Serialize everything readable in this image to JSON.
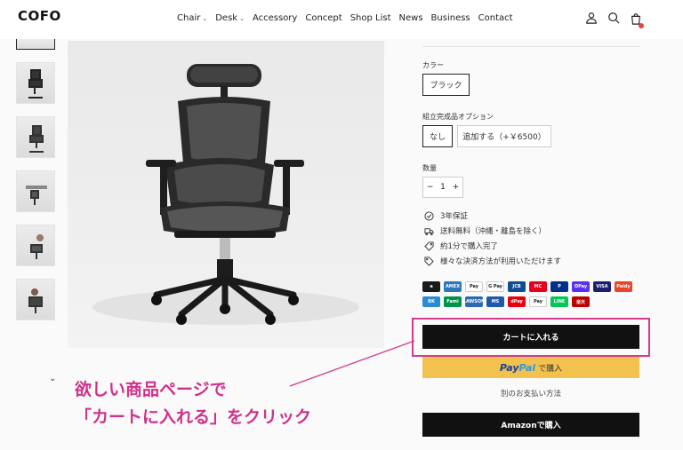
{
  "header": {
    "logo": "COFO",
    "nav": [
      {
        "label": "Chair",
        "dropdown": true
      },
      {
        "label": "Desk",
        "dropdown": true
      },
      {
        "label": "Accessory",
        "dropdown": false
      },
      {
        "label": "Concept",
        "dropdown": false
      },
      {
        "label": "Shop List",
        "dropdown": false
      },
      {
        "label": "News",
        "dropdown": false
      },
      {
        "label": "Business",
        "dropdown": false
      },
      {
        "label": "Contact",
        "dropdown": false
      }
    ],
    "icons": [
      "account-icon",
      "search-icon",
      "cart-icon"
    ]
  },
  "product": {
    "color_label": "カラー",
    "color_option": "ブラック",
    "assembly_label": "組立完成品オプション",
    "assembly_options": [
      "なし",
      "追加する（+￥6500）"
    ],
    "qty_label": "数量",
    "qty_minus": "−",
    "qty_value": "1",
    "qty_plus": "+",
    "features": [
      "3年保証",
      "送料無料（沖縄・離島を除く）",
      "約1分で購入完了",
      "様々な決済方法が利用いただけます"
    ],
    "payment_row1": [
      {
        "name": "a",
        "color": "#1a1a1a"
      },
      {
        "name": "AMEX",
        "color": "#2e77bb"
      },
      {
        "name": "Pay",
        "color": "#ffffff"
      },
      {
        "name": "G Pay",
        "color": "#ffffff"
      },
      {
        "name": "JCB",
        "color": "#0e4c96"
      },
      {
        "name": "MC",
        "color": "#eb001b"
      },
      {
        "name": "P",
        "color": "#003087"
      },
      {
        "name": "OPay",
        "color": "#5a31f4"
      },
      {
        "name": "VISA",
        "color": "#1a1f71"
      },
      {
        "name": "Paidy",
        "color": "#e8452c"
      }
    ],
    "payment_row2": [
      {
        "name": "BK",
        "color": "#2b8ad6"
      },
      {
        "name": "Fami",
        "color": "#00924a"
      },
      {
        "name": "LAWSON",
        "color": "#2c6bb3"
      },
      {
        "name": "MS",
        "color": "#1e5aa8"
      },
      {
        "name": "dPay",
        "color": "#e60012"
      },
      {
        "name": "Pay",
        "color": "#ffffff"
      },
      {
        "name": "LINE",
        "color": "#06c755"
      },
      {
        "name": "楽天",
        "color": "#bf0000"
      }
    ],
    "add_to_cart": "カートに入れる",
    "paypal_word1": "Pay",
    "paypal_word2": "Pal",
    "paypal_suffix": "で購入",
    "other_payment": "別のお支払い方法",
    "amazon_button": "Amazonで購入"
  },
  "callout": {
    "line1": "欲しい商品ページで",
    "line2": "「カートに入れる」をクリック"
  },
  "colors": {
    "highlight": "#d43a8d",
    "paypal_bg": "#f2c14e"
  }
}
